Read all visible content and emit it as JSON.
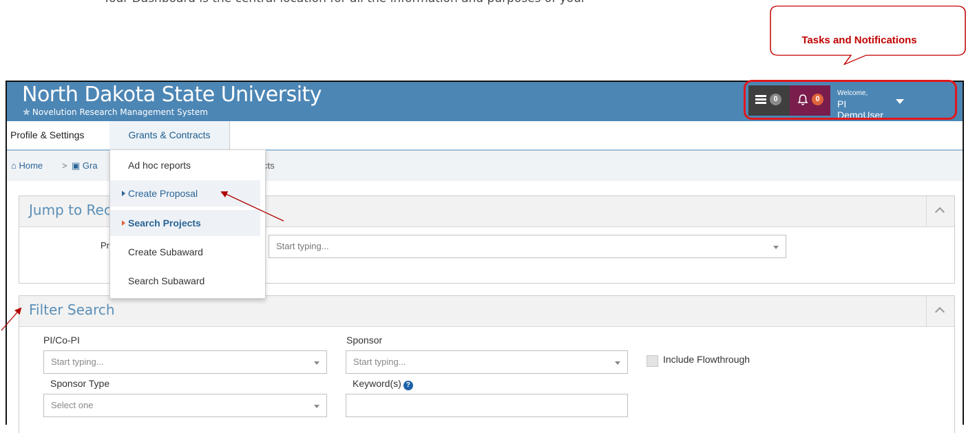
{
  "doc": {
    "top_text": "Your Dashboard is the central location for all the information and purposes of your",
    "callout_label": "Tasks and Notifications"
  },
  "header": {
    "title": "North Dakota State University",
    "subtitle": "Novelution Research Management System",
    "tasks_count": "0",
    "notifications_count": "0",
    "welcome": "Welcome,",
    "username": "PI DemoUser"
  },
  "nav": {
    "items": [
      {
        "label": "Profile & Settings"
      },
      {
        "label": "Grants & Contracts"
      }
    ]
  },
  "breadcrumb": {
    "home": "Home",
    "separator": ">",
    "grants": "Gra",
    "tail": "cts"
  },
  "menu": {
    "items": [
      {
        "label": "Ad hoc reports"
      },
      {
        "label": "Create Proposal"
      },
      {
        "label": "Search Projects"
      },
      {
        "label": "Create Subaward"
      },
      {
        "label": "Search Subaward"
      }
    ]
  },
  "jump": {
    "title": "Jump to Rec",
    "field_label": "Pr",
    "placeholder": "Start typing..."
  },
  "filter": {
    "title": "Filter Search",
    "pi_label": "PI/Co-PI",
    "pi_placeholder": "Start typing...",
    "sponsor_label": "Sponsor",
    "sponsor_placeholder": "Start typing...",
    "flowthrough_label": "Include Flowthrough",
    "sponsor_type_label": "Sponsor Type",
    "sponsor_type_placeholder": "Select one",
    "keyword_label": "Keyword(s)"
  },
  "colors": {
    "header_blue": "#4c86b5",
    "tasks_bg": "#3f3f3f",
    "notif_bg": "#7a1d4d",
    "annotation_red": "#c00000"
  }
}
